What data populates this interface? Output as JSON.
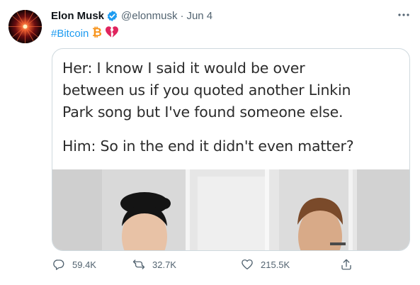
{
  "author": {
    "name": "Elon Musk",
    "handle": "@elonmusk",
    "separator": "·",
    "date": "Jun 4",
    "avatar_icon": "avatar-image"
  },
  "tweet": {
    "hashtag": "#Bitcoin",
    "emojis": [
      "bitcoin-icon",
      "broken-heart-icon"
    ]
  },
  "media": {
    "lines": [
      "Her: I know I said it would be over",
      "between us if you quoted another Linkin",
      "Park song but I've found someone else.",
      "Him: So in the end it didn't even matter?"
    ]
  },
  "actions": {
    "replies": "59.4K",
    "retweets": "32.7K",
    "likes": "215.5K"
  },
  "colors": {
    "accent": "#1d9bf0",
    "secondary_text": "#536471",
    "bitcoin": "#f7931a",
    "heart": "#e0245e"
  },
  "more_icon": "more-icon"
}
